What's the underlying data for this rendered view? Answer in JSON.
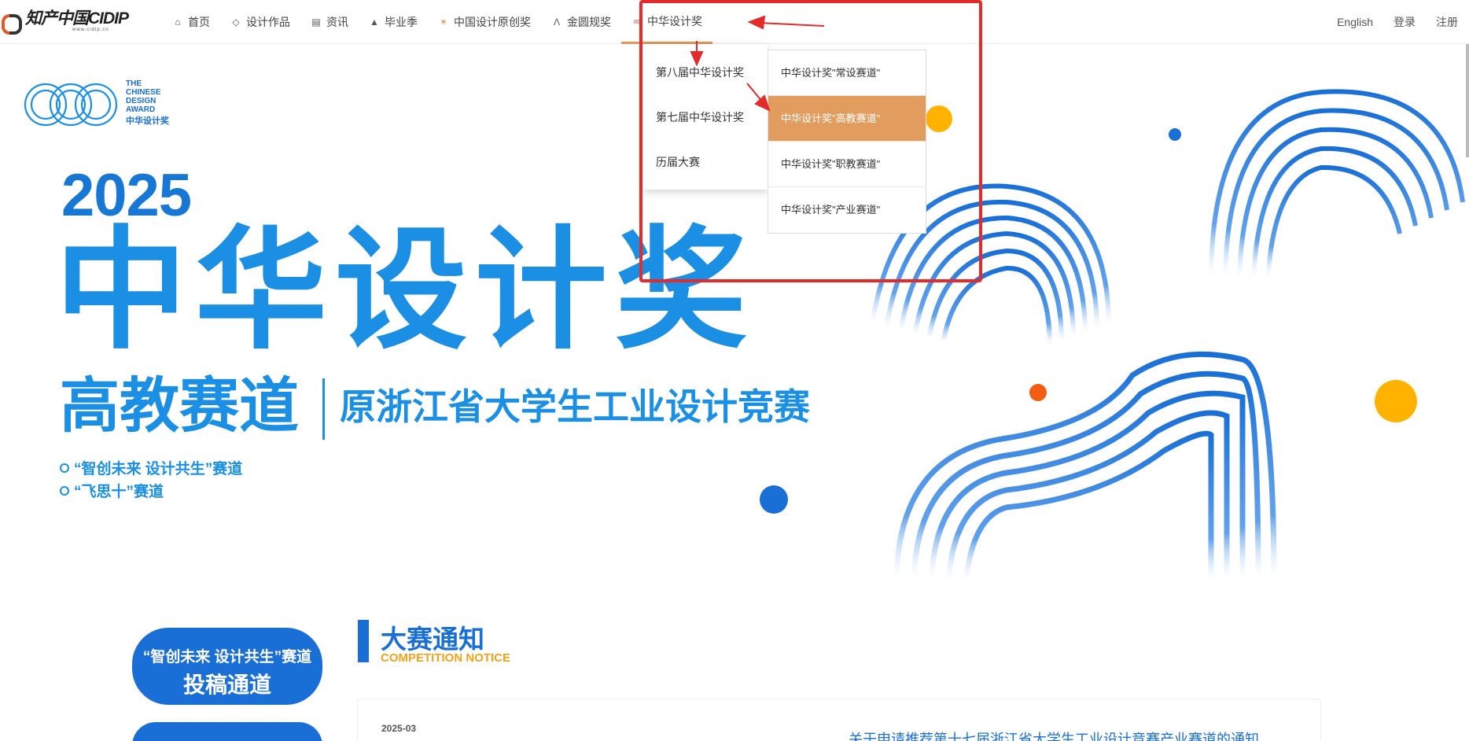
{
  "logo": {
    "main": "知产中国CIDIP",
    "sub": "www.cidip.cn"
  },
  "nav": {
    "items": [
      {
        "icon": "home-icon",
        "glyph": "⌂",
        "label": "首页"
      },
      {
        "icon": "diamond-icon",
        "glyph": "◇",
        "label": "设计作品"
      },
      {
        "icon": "newspaper-icon",
        "glyph": "▤",
        "label": "资讯"
      },
      {
        "icon": "graduation-cap-icon",
        "glyph": "▲",
        "label": "毕业季"
      },
      {
        "icon": "award-icon",
        "glyph": "✶",
        "label": "中国设计原创奖"
      },
      {
        "icon": "compass-icon",
        "glyph": "Λ",
        "label": "金圆规奖"
      },
      {
        "icon": "link-icon",
        "glyph": "∞",
        "label": "中华设计奖"
      }
    ],
    "right": {
      "english": "English",
      "login": "登录",
      "register": "注册"
    }
  },
  "dropdown": {
    "level1": [
      "第八届中华设计奖",
      "第七届中华设计奖",
      "历届大赛"
    ],
    "level2": [
      "中华设计奖\"常设赛道\"",
      "中华设计奖\"高教赛道\"",
      "中华设计奖\"职教赛道\"",
      "中华设计奖\"产业赛道\""
    ],
    "highlighted_index": 1
  },
  "banner": {
    "logo_en": [
      "THE",
      "CHINESE",
      "DESIGN",
      "AWARD"
    ],
    "logo_cn": "中华设计奖",
    "year": "2025",
    "title": "中华设计奖",
    "subtitle_left": "高教赛道",
    "subtitle_right": "原浙江省大学生工业设计竞赛",
    "tracks": [
      "“智创未来 设计共生”赛道",
      "“飞思十”赛道"
    ]
  },
  "sidebar": {
    "submit_line1": "“智创未来 设计共生”赛道",
    "submit_line2": "投稿通道"
  },
  "notice": {
    "title": "大赛通知",
    "title_en": "COMPETITION NOTICE",
    "items": [
      {
        "date": "2025-03",
        "title": "关于申请推荐第十七届浙江省大学生工业设计竞赛产业赛道的通知"
      }
    ]
  },
  "colors": {
    "brand_blue": "#1a6fd6",
    "title_blue": "#1a8fe3",
    "highlight_orange": "#e29d5e",
    "annotation_red": "#e42b2b",
    "accent_yellow": "#f0a21b"
  }
}
